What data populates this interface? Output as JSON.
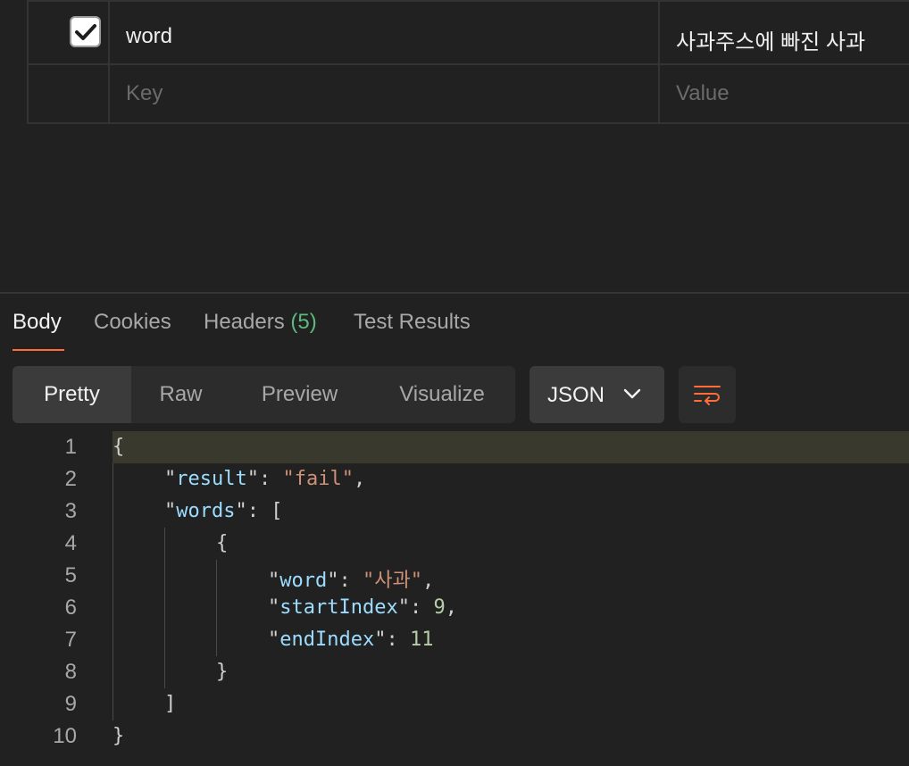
{
  "params": {
    "rows": [
      {
        "checked": true,
        "key": "word",
        "value": "사과주스에 빠진 사과"
      },
      {
        "checked": false,
        "key": "Key",
        "value": "Value",
        "placeholder": true
      }
    ]
  },
  "response": {
    "tabs": [
      {
        "label": "Body",
        "active": true
      },
      {
        "label": "Cookies"
      },
      {
        "label": "Headers",
        "count": "(5)"
      },
      {
        "label": "Test Results"
      }
    ],
    "views": [
      "Pretty",
      "Raw",
      "Preview",
      "Visualize"
    ],
    "active_view": "Pretty",
    "format": "JSON",
    "icons": {
      "wrap": "wrap-lines-icon",
      "dropdown": "chevron-down-icon",
      "check": "check-icon"
    },
    "colors": {
      "accent": "#ff6c37",
      "count": "#5cba7d",
      "key": "#9cdcfe",
      "string": "#ce9178",
      "number": "#b5cea8"
    }
  },
  "code": {
    "line_numbers": [
      "1",
      "2",
      "3",
      "4",
      "5",
      "6",
      "7",
      "8",
      "9",
      "10"
    ],
    "json": {
      "result_key": "result",
      "result_value": "fail",
      "words_key": "words",
      "word_key": "word",
      "word_value": "사과",
      "start_key": "startIndex",
      "start_value": "9",
      "end_key": "endIndex",
      "end_value": "11"
    }
  }
}
